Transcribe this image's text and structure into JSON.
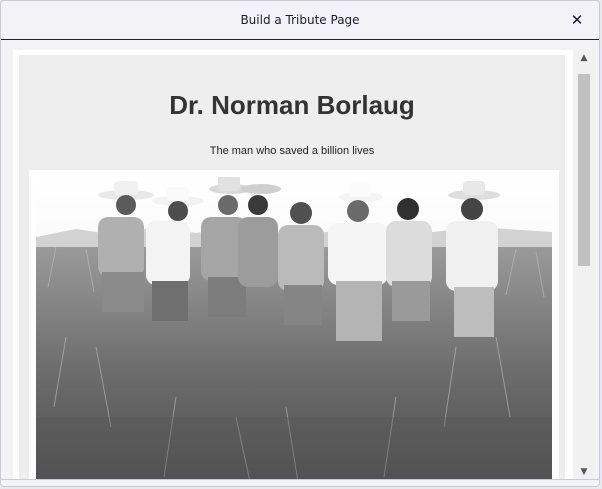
{
  "modal": {
    "title": "Build a Tribute Page",
    "close_icon": "close-icon",
    "close_glyph": "✕"
  },
  "tribute_page": {
    "title": "Dr. Norman Borlaug",
    "subtitle": "The man who saved a billion lives"
  },
  "scrollbar": {
    "up_glyph": "▲",
    "down_glyph": "▼"
  },
  "colors": {
    "modal_background": "#f3f3f7",
    "page_background": "#eeeeee",
    "header_divider": "#22232a",
    "text_dark": "#1b1b32"
  }
}
